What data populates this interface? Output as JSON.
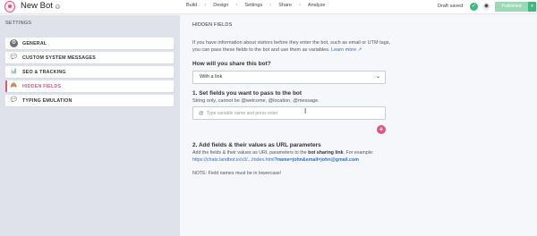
{
  "header": {
    "bot_name": "New Bot",
    "nav": [
      "Build",
      "Design",
      "Settings",
      "Share",
      "Analyze"
    ],
    "nav_separator": "›",
    "status": "Draft saved",
    "publish_label": "Published",
    "publish_caret": "▾"
  },
  "sidebar": {
    "title": "SETTINGS",
    "items": [
      {
        "label": "GENERAL",
        "icon": "gear-icon",
        "glyph": "⚙",
        "color": "#6b6f78"
      },
      {
        "label": "CUSTOM SYSTEM MESSAGES",
        "icon": "speech-bubble-icon",
        "glyph": "💬",
        "color": "#888"
      },
      {
        "label": "SEO & TRACKING",
        "icon": "chart-icon",
        "glyph": "📊",
        "color": "#d77"
      },
      {
        "label": "HIDDEN FIELDS",
        "icon": "hidden-fields-icon",
        "glyph": "🙈",
        "color": "#c86"
      },
      {
        "label": "TYPING EMULATION",
        "icon": "typing-bubble-icon",
        "glyph": "💬",
        "color": "#888"
      }
    ],
    "active_index": 3
  },
  "main": {
    "title": "HIDDEN FIELDS",
    "intro": "If you have information about visitors before they enter the bot, such as email or UTM tags, you can pass these fields to the bot and use them as variables.",
    "learn_more": "Learn more",
    "share_question": "How will you share this bot?",
    "share_select_value": "With a link",
    "step1_title": "1. Set fields you want to pass to the bot",
    "step1_sub": "String only, cannot be @welcome, @location, @message.",
    "var_at": "@",
    "var_placeholder": "Type variable name and press enter",
    "add_label": "+",
    "step2_title": "2. Add fields & their values as URL parameters",
    "step2_text_a": "Add the fields & their values as URL parameters to the",
    "step2_bold": "bot sharing link",
    "step2_text_b": ". For example:",
    "example_url": "https://chats.landbot.io/v3/.../index.html",
    "example_params": "?name=john&email=john@gmail.com",
    "note": "NOTE: Field names must be in lowercase!"
  },
  "colors": {
    "accent": "#e0567a",
    "success": "#3fb97d",
    "link": "#2f6fd1"
  }
}
